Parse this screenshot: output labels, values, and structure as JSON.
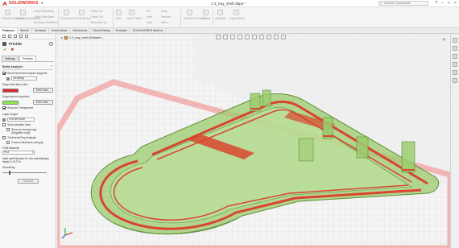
{
  "app": {
    "brand": "SOLIDWORKS",
    "document_title": "1-3_tray_shell.sldprt *",
    "search_placeholder": "Search Commands"
  },
  "ribbon": {
    "groups": [
      "Extruded Boss/Base",
      "Revolved Boss/Base",
      "Swept Boss/Base",
      "Lofted Boss/Base",
      "Boundary Boss/Base",
      "Extruded Cut",
      "Hole Wizard",
      "Swept Cut",
      "Lofted Cut",
      "Boundary Cut",
      "Fillet",
      "Linear Pattern",
      "Rib",
      "Draft",
      "Shell",
      "Wrap",
      "Intersect",
      "Mirror",
      "Reference Geometry",
      "Curves",
      "Instant3D",
      "Rapid Sketch"
    ]
  },
  "tabs": [
    {
      "label": "Features",
      "active": true
    },
    {
      "label": "Sketch",
      "active": false
    },
    {
      "label": "Surfaces",
      "active": false
    },
    {
      "label": "Sheet Metal",
      "active": false
    },
    {
      "label": "Weldments",
      "active": false
    },
    {
      "label": "Direct Editing",
      "active": false
    },
    {
      "label": "Evaluate",
      "active": false
    },
    {
      "label": "SOLIDWORKS Add-Ins",
      "active": false
    }
  ],
  "property_manager": {
    "title": "Print3D",
    "subtabs": [
      {
        "label": "Settings",
        "active": false
      },
      {
        "label": "Preview",
        "active": true
      }
    ],
    "build_analysis": {
      "heading": "Build Analysis",
      "show_faces_label": "Show faces that require supports",
      "show_faces_checked": true,
      "angle_value": "45.00deg",
      "supported_face_color_label": "Supported face color:",
      "supported_face_color": "#d92b2b",
      "edit_color_label": "Edit Color...",
      "supports_not_required_label": "Supports not required:",
      "supports_not_required_color": "#8ee84a",
      "show_transparent_label": "Show as Transparent",
      "show_transparent_checked": true
    },
    "layer": {
      "layer_height_label": "Layer height:",
      "layer_height_value": "0.00787402in",
      "show_striation_label": "Show striation lines",
      "show_striation_checked": false,
      "show_during_mag_label": "Show on during mag",
      "magnifier_only_label": "(Magnifier only)",
      "thickness_gap_label": "Thickness/Gap Analysis",
      "thickness_gap_checked": false,
      "custom_thickness_label": "Custom thickness and gap",
      "fdm_material_label": "FDM Material:",
      "fdm_material_value": "PLA",
      "ideal_wall_note": "Ideal wall thickness for this material/layer height: 0.0177in",
      "sensitivity_label": "Sensitivity:",
      "sensitivity_level": 0.15,
      "calculate_label": "Calculate"
    }
  },
  "viewport": {
    "tree_label": "1-3_tray_shell (Default<...",
    "overhang_color": "#d9452e",
    "supported_color": "#9ccc6e",
    "floor_grid_color": "#d8d8d8",
    "build_plate_border_color": "#f2b5b5"
  }
}
